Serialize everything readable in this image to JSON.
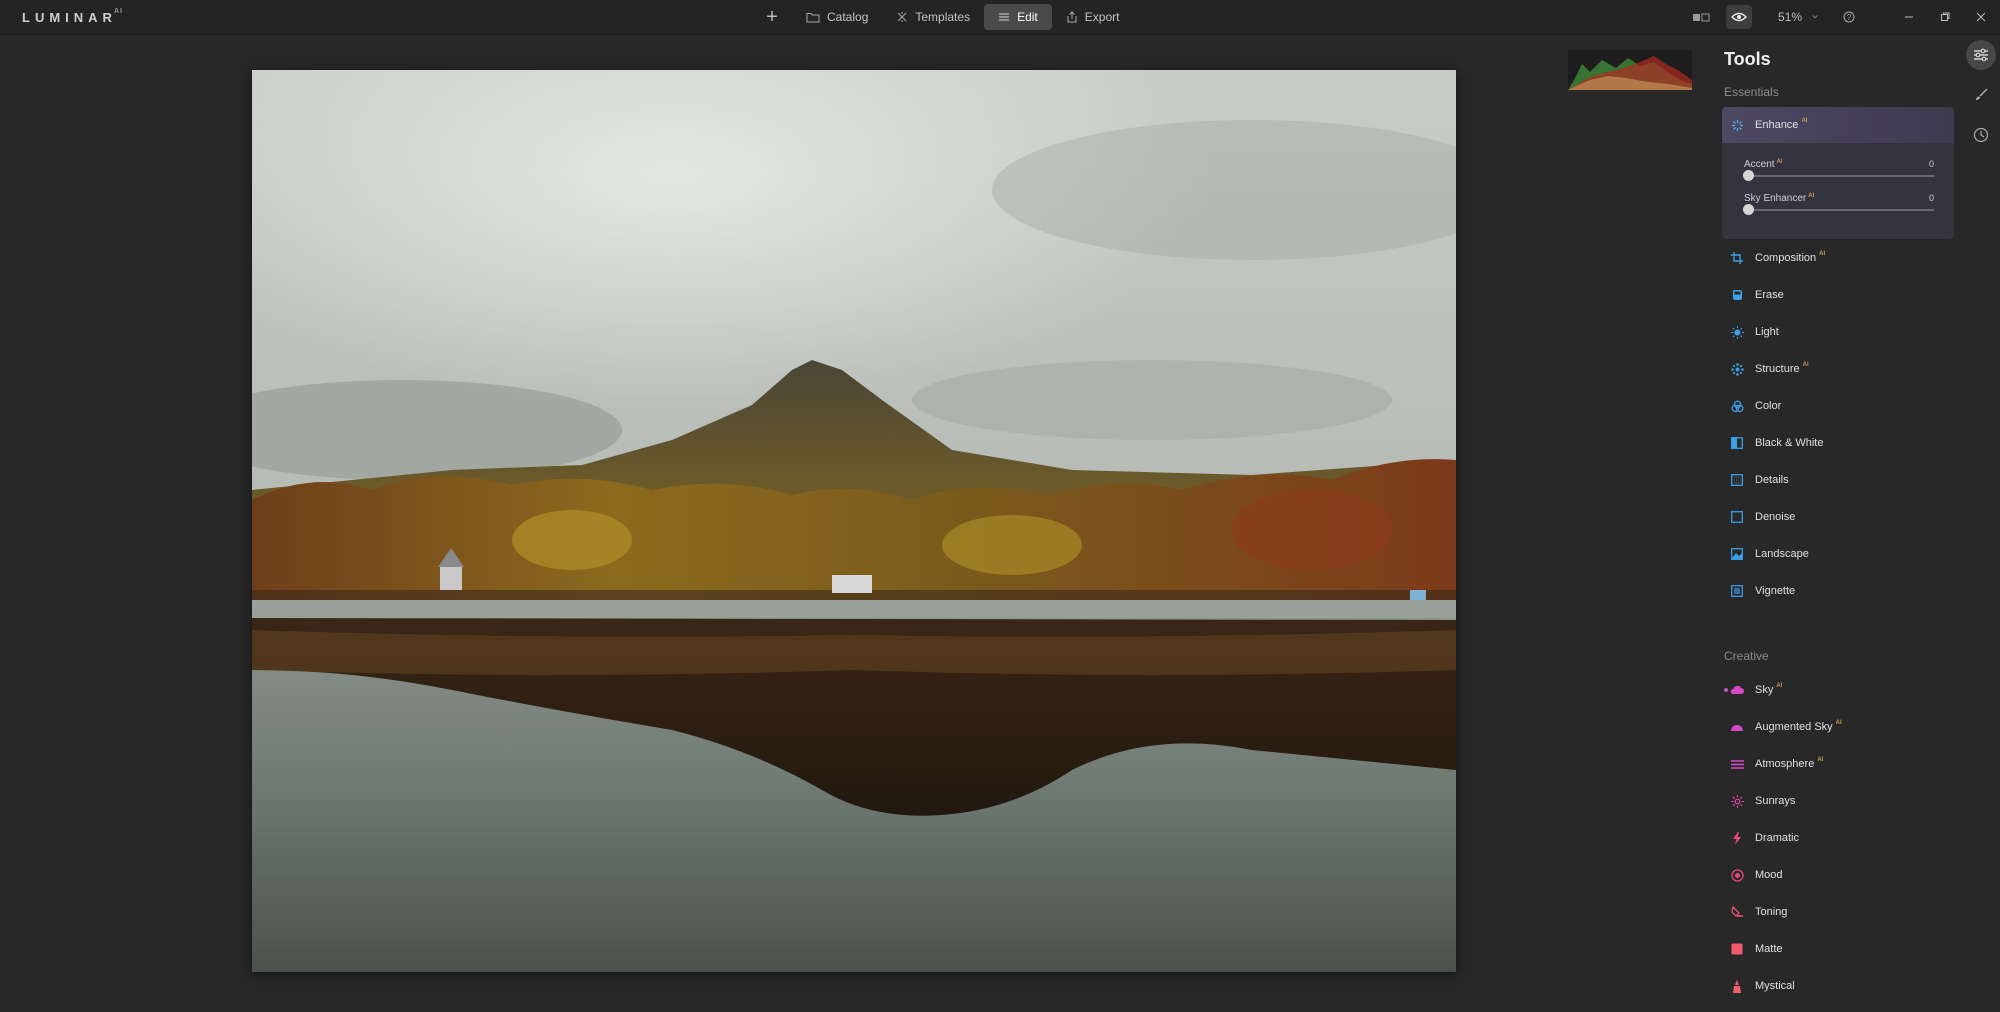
{
  "app": {
    "name": "LUMINAR",
    "badge": "AI"
  },
  "nav": {
    "add_label": "+",
    "tabs": [
      {
        "label": "Catalog"
      },
      {
        "label": "Templates"
      },
      {
        "label": "Edit"
      },
      {
        "label": "Export"
      }
    ],
    "active_tab": "Edit"
  },
  "view": {
    "zoom": "51%"
  },
  "tools": {
    "title": "Tools",
    "essentials_label": "Essentials",
    "enhance": {
      "label": "Enhance",
      "ai": "AI",
      "sliders": [
        {
          "label": "Accent",
          "ai": "AI",
          "value": "0"
        },
        {
          "label": "Sky Enhancer",
          "ai": "AI",
          "value": "0"
        }
      ]
    },
    "essentials": [
      {
        "label": "Composition",
        "ai": "AI",
        "icon": "crop-icon",
        "color": "#3aa0e8"
      },
      {
        "label": "Erase",
        "ai": "",
        "icon": "eraser-icon",
        "color": "#3aa0e8"
      },
      {
        "label": "Light",
        "ai": "",
        "icon": "sun-icon",
        "color": "#3aa0e8"
      },
      {
        "label": "Structure",
        "ai": "AI",
        "icon": "structure-icon",
        "color": "#3aa0e8"
      },
      {
        "label": "Color",
        "ai": "",
        "icon": "color-icon",
        "color": "#3aa0e8"
      },
      {
        "label": "Black & White",
        "ai": "",
        "icon": "black-white-icon",
        "color": "#3aa0e8"
      },
      {
        "label": "Details",
        "ai": "",
        "icon": "details-icon",
        "color": "#3aa0e8"
      },
      {
        "label": "Denoise",
        "ai": "",
        "icon": "denoise-icon",
        "color": "#3aa0e8"
      },
      {
        "label": "Landscape",
        "ai": "",
        "icon": "landscape-icon",
        "color": "#3aa0e8"
      },
      {
        "label": "Vignette",
        "ai": "",
        "icon": "vignette-icon",
        "color": "#3aa0e8"
      }
    ],
    "creative_label": "Creative",
    "creative": [
      {
        "label": "Sky",
        "ai": "AI",
        "icon": "cloud-icon",
        "color": "#d548c8"
      },
      {
        "label": "Augmented Sky",
        "ai": "AI",
        "icon": "augmented-sky-icon",
        "color": "#d548c8"
      },
      {
        "label": "Atmosphere",
        "ai": "AI",
        "icon": "atmosphere-icon",
        "color": "#d548c8"
      },
      {
        "label": "Sunrays",
        "ai": "",
        "icon": "sunrays-icon",
        "color": "#e0489a"
      },
      {
        "label": "Dramatic",
        "ai": "",
        "icon": "lightning-icon",
        "color": "#e8487a"
      },
      {
        "label": "Mood",
        "ai": "",
        "icon": "mood-icon",
        "color": "#e8487a"
      },
      {
        "label": "Toning",
        "ai": "",
        "icon": "toning-icon",
        "color": "#ee5070"
      },
      {
        "label": "Matte",
        "ai": "",
        "icon": "matte-icon",
        "color": "#f05a6e"
      },
      {
        "label": "Mystical",
        "ai": "",
        "icon": "mystical-icon",
        "color": "#f06070"
      }
    ]
  }
}
